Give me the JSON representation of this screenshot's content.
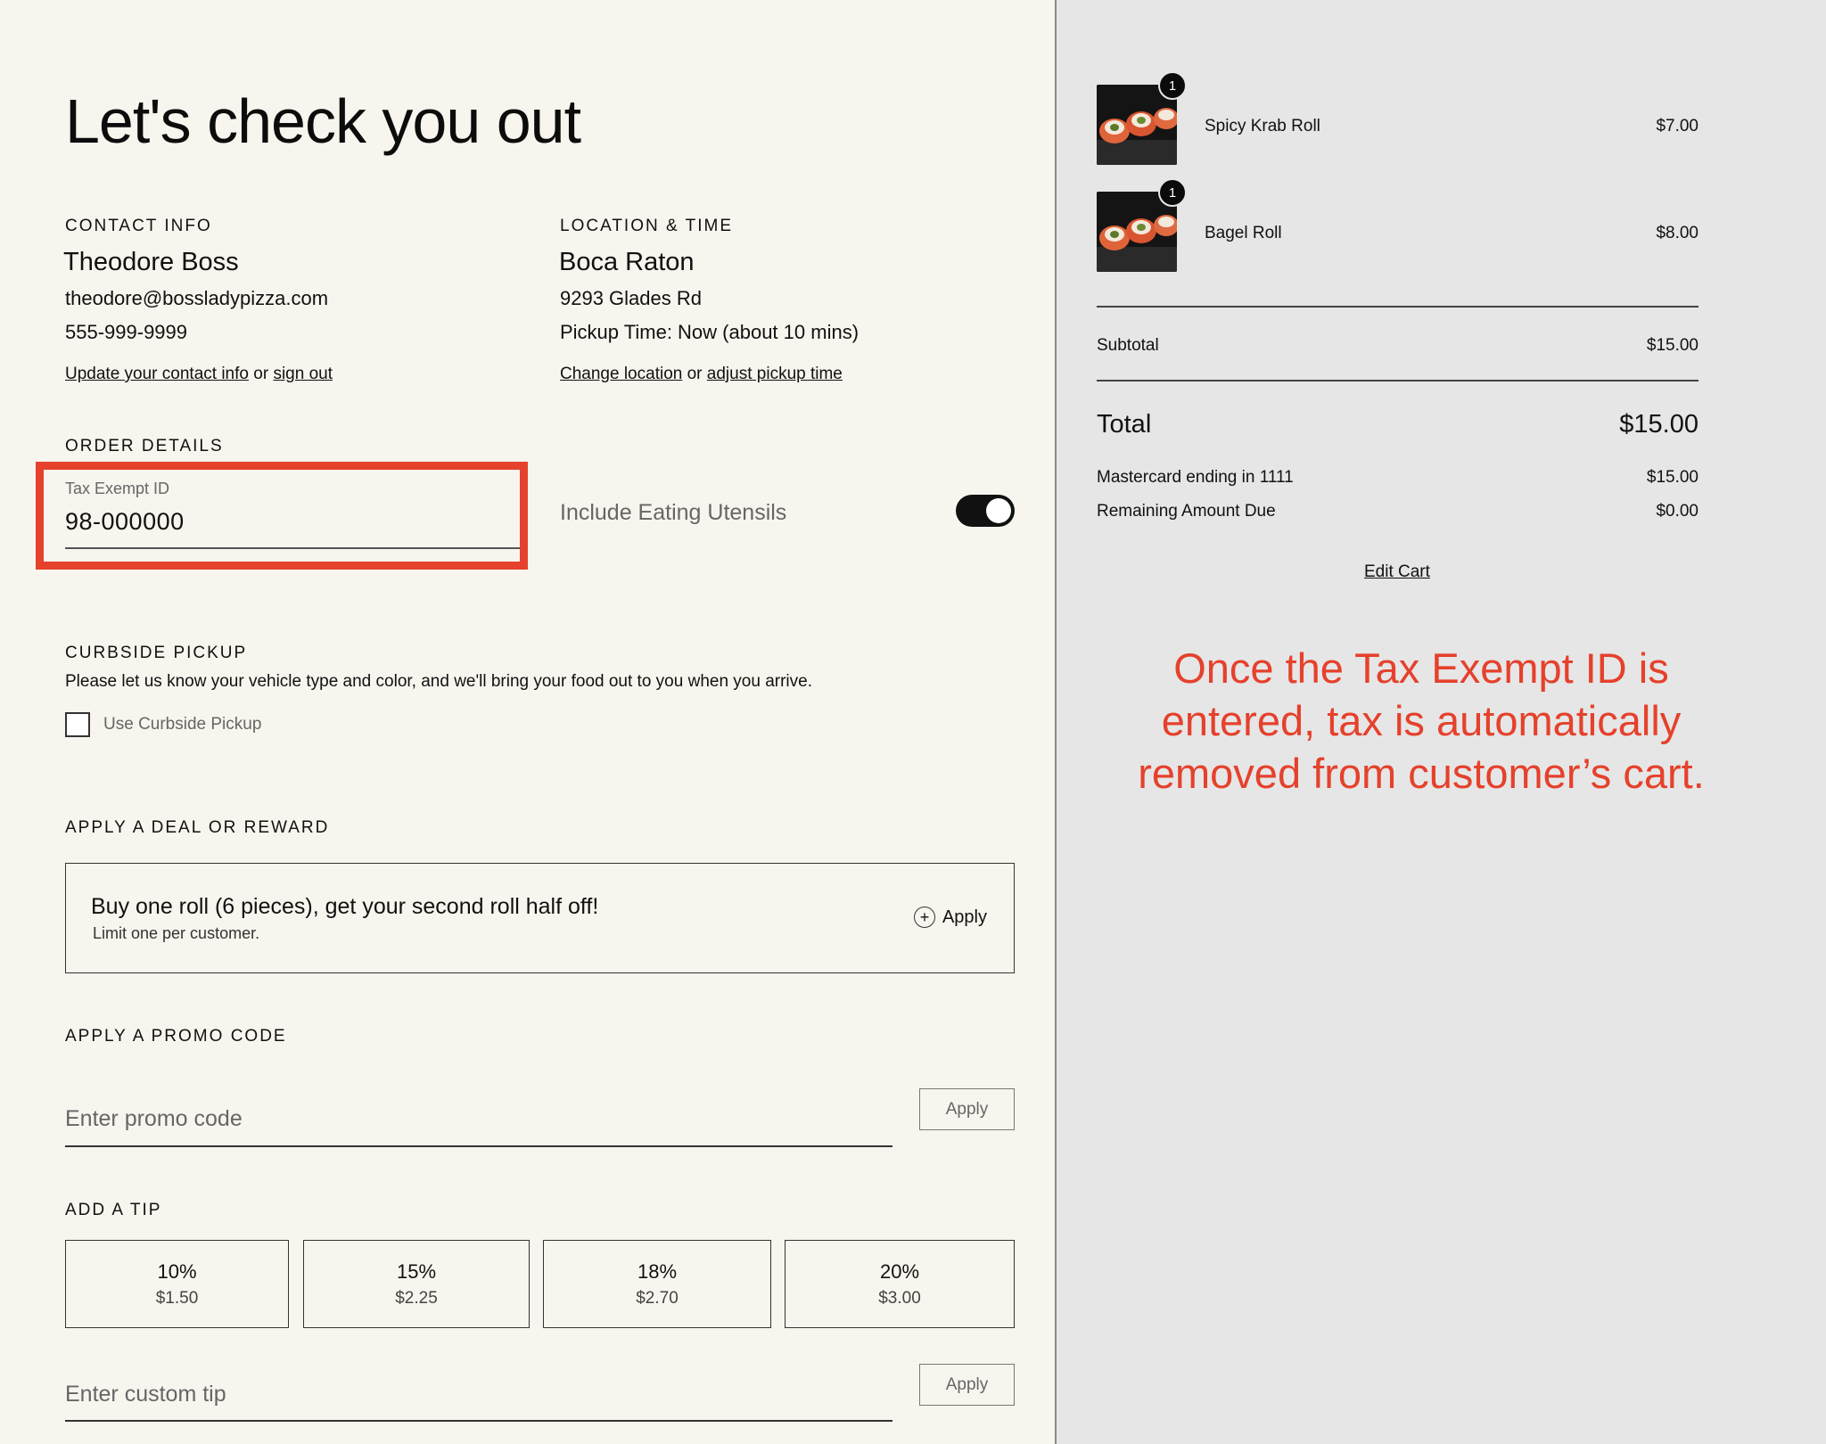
{
  "page": {
    "title": "Let's check you out"
  },
  "contact": {
    "section_label": "CONTACT INFO",
    "name": "Theodore Boss",
    "email": "theodore@bossladypizza.com",
    "phone": "555-999-9999",
    "update_link": "Update your contact info",
    "or_text": "or",
    "signout_link": "sign out"
  },
  "location": {
    "section_label": "LOCATION & TIME",
    "name": "Boca Raton",
    "address": "9293 Glades Rd",
    "pickup_time": "Pickup Time: Now (about 10 mins)",
    "change_link": "Change location",
    "or_text": "or",
    "adjust_link": "adjust pickup time"
  },
  "order_details": {
    "section_label": "ORDER DETAILS",
    "tax_label": "Tax Exempt ID",
    "tax_value": "98-000000",
    "utensils_label": "Include Eating Utensils",
    "utensils_on": true
  },
  "curbside": {
    "section_label": "CURBSIDE PICKUP",
    "description": "Please let us know your vehicle type and color, and we'll bring your food out to you when you arrive.",
    "checkbox_label": "Use Curbside Pickup"
  },
  "deal": {
    "section_label": "APPLY A DEAL OR REWARD",
    "title": "Buy one roll (6 pieces), get your second roll half off!",
    "subtitle": "Limit one per customer.",
    "apply_label": "Apply"
  },
  "promo": {
    "section_label": "APPLY A PROMO CODE",
    "placeholder": "Enter promo code",
    "apply_label": "Apply"
  },
  "tip": {
    "section_label": "ADD A TIP",
    "options": [
      {
        "pct": "10%",
        "amt": "$1.50"
      },
      {
        "pct": "15%",
        "amt": "$2.25"
      },
      {
        "pct": "18%",
        "amt": "$2.70"
      },
      {
        "pct": "20%",
        "amt": "$3.00"
      }
    ],
    "custom_placeholder": "Enter custom tip",
    "apply_label": "Apply"
  },
  "cart": {
    "items": [
      {
        "qty": "1",
        "name": "Spicy Krab Roll",
        "price": "$7.00"
      },
      {
        "qty": "1",
        "name": "Bagel Roll",
        "price": "$8.00"
      }
    ],
    "subtotal_label": "Subtotal",
    "subtotal": "$15.00",
    "total_label": "Total",
    "total": "$15.00",
    "payment_label": "Mastercard ending in 1111",
    "payment_amount": "$15.00",
    "remaining_label": "Remaining Amount Due",
    "remaining_amount": "$0.00",
    "edit_cart": "Edit Cart"
  },
  "annotation": {
    "text": "Once the Tax Exempt ID is entered, tax is automatically removed from customer’s cart.",
    "color": "#e5412c"
  }
}
